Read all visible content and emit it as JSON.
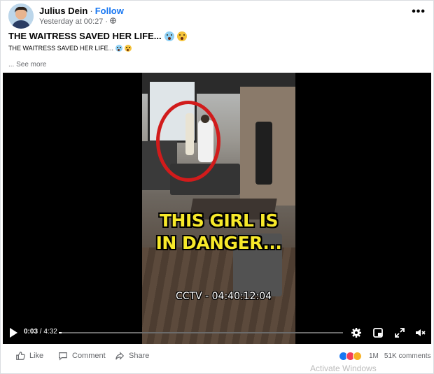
{
  "post": {
    "author": "Julius Dein",
    "separator": "·",
    "follow_label": "Follow",
    "timestamp": "Yesterday at 00:27",
    "separator2": "·",
    "more_label": "•••",
    "title": "THE WAITRESS SAVED HER LIFE...",
    "subtitle": "THE WAITRESS SAVED HER LIFE...",
    "see_more": "... See more"
  },
  "video": {
    "caption_line1": "THIS GIRL IS",
    "caption_line2": "IN DANGER...",
    "overlay_text": "CCTV - 04:40:12:04",
    "current_time": "0:03",
    "time_separator": " / ",
    "duration": "4:32",
    "progress_fraction": 0.011,
    "circle_color": "#d11b1b",
    "caption_color": "#f7e92a"
  },
  "icons": {
    "play": "play-icon",
    "settings": "gear-icon",
    "miniplayer": "picture-in-picture-icon",
    "fullscreen": "fullscreen-icon",
    "volume": "volume-muted-icon",
    "globe": "globe-icon",
    "like": "thumbs-up-icon",
    "comment": "speech-bubble-icon",
    "share": "share-arrow-icon"
  },
  "footer": {
    "like_label": "Like",
    "comment_label": "Comment",
    "share_label": "Share",
    "reaction_count": "1M",
    "comments_count": "51K comments"
  },
  "os": {
    "watermark": "Activate Windows"
  },
  "colors": {
    "accent": "#1877f2",
    "secondary_text": "#65676b",
    "like": "#1877f2",
    "love": "#f33e58",
    "haha": "#f7b125"
  }
}
